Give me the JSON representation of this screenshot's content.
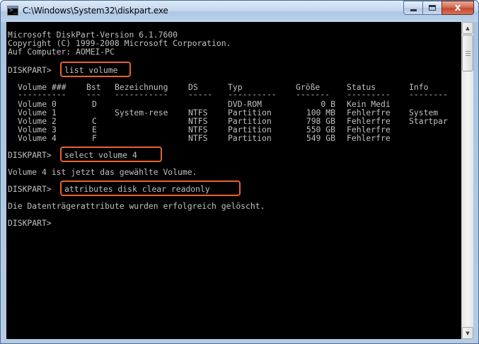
{
  "window": {
    "title": "C:\\Windows\\System32\\diskpart.exe",
    "close_label": "x"
  },
  "console": {
    "header": [
      "Microsoft DiskPart-Version 6.1.7600",
      "Copyright (C) 1999-2008 Microsoft Corporation.",
      "Auf Computer: AOMEI-PC"
    ],
    "prompt": "DISKPART>",
    "commands": [
      "list volume",
      "select volume 4",
      "attributes disk clear readonly"
    ],
    "table": {
      "headers": [
        "Volume ###",
        "Bst",
        "Bezeichnung",
        "DS",
        "Typ",
        "Größe",
        "Status",
        "Info"
      ],
      "separators": [
        "----------",
        "---",
        "-----------",
        "-----",
        "----------",
        "-------",
        "---------",
        "--------"
      ],
      "rows": [
        [
          "Volume 0",
          "D",
          "",
          "",
          "DVD-ROM",
          "0 B",
          "Kein Medi",
          ""
        ],
        [
          "Volume 1",
          "",
          "System-rese",
          "NTFS",
          "Partition",
          "100 MB",
          "Fehlerfre",
          "System"
        ],
        [
          "Volume 2",
          "C",
          "",
          "NTFS",
          "Partition",
          "798 GB",
          "Fehlerfre",
          "Startpar"
        ],
        [
          "Volume 3",
          "E",
          "",
          "NTFS",
          "Partition",
          "550 GB",
          "Fehlerfre",
          ""
        ],
        [
          "Volume 4",
          "F",
          "",
          "NTFS",
          "Partition",
          "549 GB",
          "Fehlerfre",
          ""
        ]
      ]
    },
    "responses": [
      "Volume 4 ist jetzt das gewählte Volume.",
      "Die Datenträgerattribute wurden erfolgreich gelöscht."
    ]
  },
  "colors": {
    "console_bg": "#000000",
    "console_text": "#c0c0c0",
    "highlight": "#e8632a"
  }
}
